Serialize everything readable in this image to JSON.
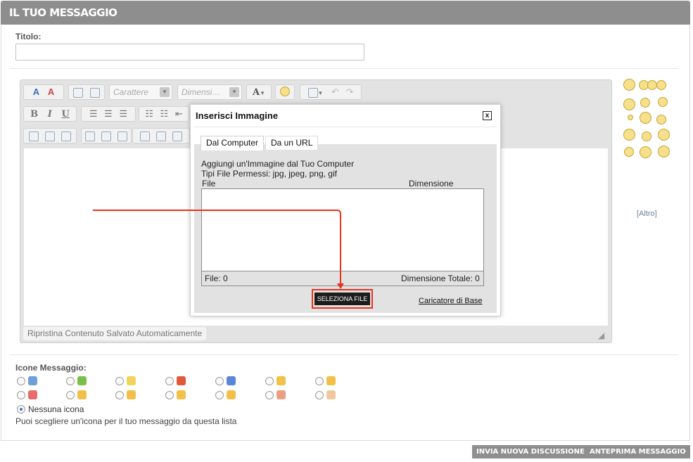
{
  "header": {
    "title": "Il Tuo Messaggio"
  },
  "title_field": {
    "label": "Titolo:",
    "value": "",
    "placeholder": ""
  },
  "toolbar": {
    "font_select": "Carattere",
    "size_select": "Dimensi…",
    "font_color_letter": "A",
    "bold": "B",
    "italic": "I",
    "underline": "U"
  },
  "editor": {
    "restore_label": "Ripristina Contenuto Salvato Automaticamente"
  },
  "smilies": {
    "more_label": "[Altro]"
  },
  "message_icons": {
    "label": "Icone Messaggio:",
    "none_label": "Nessuna icona",
    "hint": "Puoi scegliere un'icona per il tuo messaggio da questa lista",
    "icon_colors": [
      "#6f9fd8",
      "#7bbf4a",
      "#f2d45c",
      "#e05a3a",
      "#5a86d6",
      "#f0c24a",
      "#f2c04a",
      "#e86c6c",
      "#f2c04a",
      "#f2c04a",
      "#f2c04a",
      "#f2c04a",
      "#e8a080",
      "#f0c8a0"
    ]
  },
  "modal": {
    "title": "Inserisci Immagine",
    "close_label": "x",
    "tabs": [
      "Dal Computer",
      "Da un URL"
    ],
    "add_text": "Aggiungi un'Immagine dal Tuo Computer",
    "types_text": "Tipi File Permessi: jpg, jpeg, png, gif",
    "col_file": "File",
    "col_size": "Dimensione",
    "files_count": "File: 0",
    "total_size": "Dimensione Totale: 0",
    "select_button": "SELEZIONA FILE",
    "basic_uploader": "Caricatore di Base"
  },
  "footer": {
    "submit_button": "INVIA NUOVA DISCUSSIONE",
    "preview_button": "ANTEPRIMA MESSAGGIO"
  },
  "colors": {
    "header_bg": "#8e8e8e",
    "accent_red": "#e8331e",
    "select_btn_bg": "#1c1c1c"
  }
}
